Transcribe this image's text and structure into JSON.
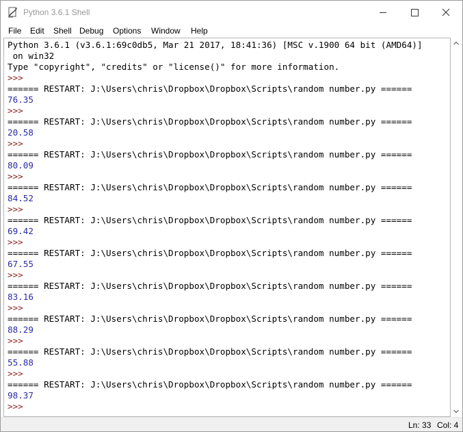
{
  "window": {
    "title": "Python 3.6.1 Shell",
    "icon": "python-idle-icon",
    "controls": [
      "minimize-icon",
      "maximize-icon",
      "close-icon"
    ]
  },
  "menu": {
    "items": [
      {
        "label": "File"
      },
      {
        "label": "Edit"
      },
      {
        "label": "Shell"
      },
      {
        "label": "Debug"
      },
      {
        "label": "Options"
      },
      {
        "label": "Window"
      },
      {
        "label": "Help"
      }
    ]
  },
  "shell": {
    "lines": [
      {
        "kind": "normal",
        "text": "Python 3.6.1 (v3.6.1:69c0db5, Mar 21 2017, 18:41:36) [MSC v.1900 64 bit (AMD64)]"
      },
      {
        "kind": "normal",
        "text": " on win32"
      },
      {
        "kind": "normal",
        "text": "Type \"copyright\", \"credits\" or \"license()\" for more information."
      },
      {
        "kind": "prompt",
        "text": ">>> "
      },
      {
        "kind": "normal",
        "text": "====== RESTART: J:\\Users\\chris\\Dropbox\\Dropbox\\Scripts\\random number.py ======"
      },
      {
        "kind": "output",
        "text": "76.35"
      },
      {
        "kind": "prompt",
        "text": ">>> "
      },
      {
        "kind": "normal",
        "text": "====== RESTART: J:\\Users\\chris\\Dropbox\\Dropbox\\Scripts\\random number.py ======"
      },
      {
        "kind": "output",
        "text": "20.58"
      },
      {
        "kind": "prompt",
        "text": ">>> "
      },
      {
        "kind": "normal",
        "text": "====== RESTART: J:\\Users\\chris\\Dropbox\\Dropbox\\Scripts\\random number.py ======"
      },
      {
        "kind": "output",
        "text": "80.09"
      },
      {
        "kind": "prompt",
        "text": ">>> "
      },
      {
        "kind": "normal",
        "text": "====== RESTART: J:\\Users\\chris\\Dropbox\\Dropbox\\Scripts\\random number.py ======"
      },
      {
        "kind": "output",
        "text": "84.52"
      },
      {
        "kind": "prompt",
        "text": ">>> "
      },
      {
        "kind": "normal",
        "text": "====== RESTART: J:\\Users\\chris\\Dropbox\\Dropbox\\Scripts\\random number.py ======"
      },
      {
        "kind": "output",
        "text": "69.42"
      },
      {
        "kind": "prompt",
        "text": ">>> "
      },
      {
        "kind": "normal",
        "text": "====== RESTART: J:\\Users\\chris\\Dropbox\\Dropbox\\Scripts\\random number.py ======"
      },
      {
        "kind": "output",
        "text": "67.55"
      },
      {
        "kind": "prompt",
        "text": ">>> "
      },
      {
        "kind": "normal",
        "text": "====== RESTART: J:\\Users\\chris\\Dropbox\\Dropbox\\Scripts\\random number.py ======"
      },
      {
        "kind": "output",
        "text": "83.16"
      },
      {
        "kind": "prompt",
        "text": ">>> "
      },
      {
        "kind": "normal",
        "text": "====== RESTART: J:\\Users\\chris\\Dropbox\\Dropbox\\Scripts\\random number.py ======"
      },
      {
        "kind": "output",
        "text": "88.29"
      },
      {
        "kind": "prompt",
        "text": ">>> "
      },
      {
        "kind": "normal",
        "text": "====== RESTART: J:\\Users\\chris\\Dropbox\\Dropbox\\Scripts\\random number.py ======"
      },
      {
        "kind": "output",
        "text": "55.88"
      },
      {
        "kind": "prompt",
        "text": ">>> "
      },
      {
        "kind": "normal",
        "text": "====== RESTART: J:\\Users\\chris\\Dropbox\\Dropbox\\Scripts\\random number.py ======"
      },
      {
        "kind": "output",
        "text": "98.37"
      },
      {
        "kind": "prompt",
        "text": ">>> "
      }
    ]
  },
  "status": {
    "line": "Ln: 33",
    "col": "Col: 4"
  },
  "colors": {
    "prompt": "#8a1a1a",
    "output": "#2a2aa8",
    "text": "#000000"
  }
}
